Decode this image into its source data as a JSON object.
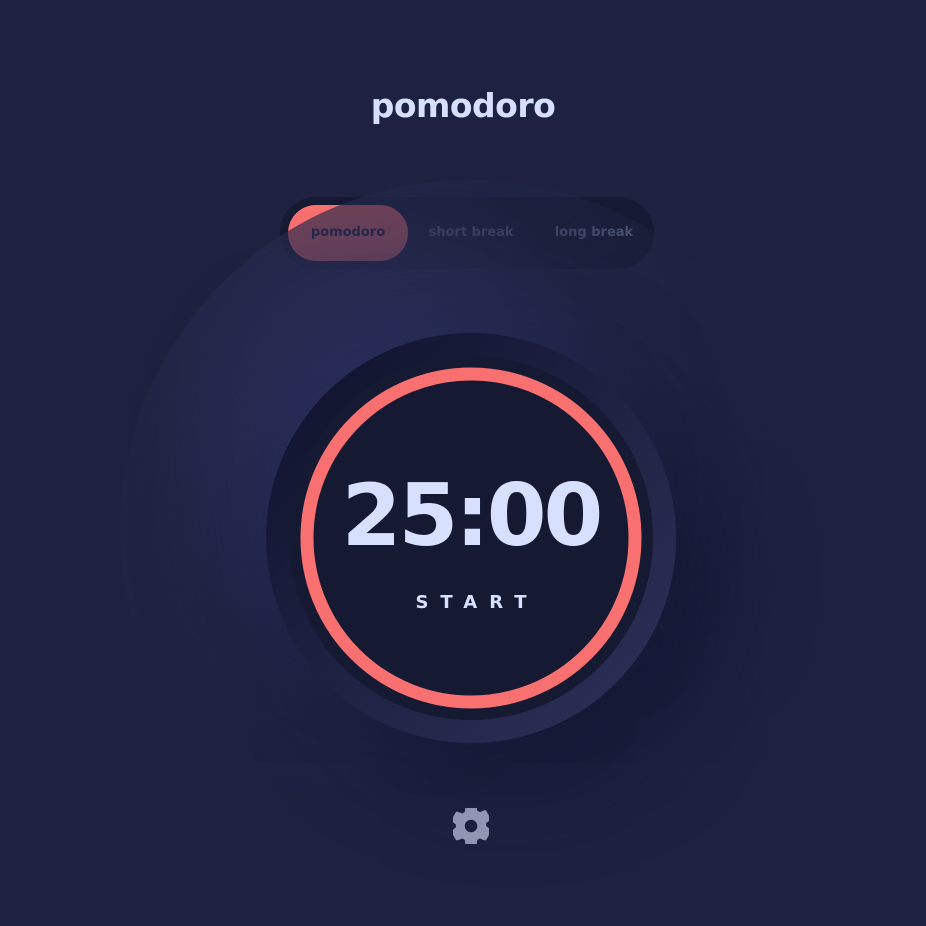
{
  "header": {
    "title": "pomodoro"
  },
  "modes": {
    "tabs": [
      {
        "label": "pomodoro",
        "active": true
      },
      {
        "label": "short break",
        "active": false
      },
      {
        "label": "long break",
        "active": false
      }
    ]
  },
  "timer": {
    "time": "25:00",
    "action_label": "START",
    "progress": 1.0
  },
  "settings": {
    "icon": "gear-icon"
  },
  "colors": {
    "accent": "#f87070",
    "background": "#1e2140",
    "panel": "#161932",
    "text": "#d7e0fe",
    "muted": "#5e6787"
  }
}
